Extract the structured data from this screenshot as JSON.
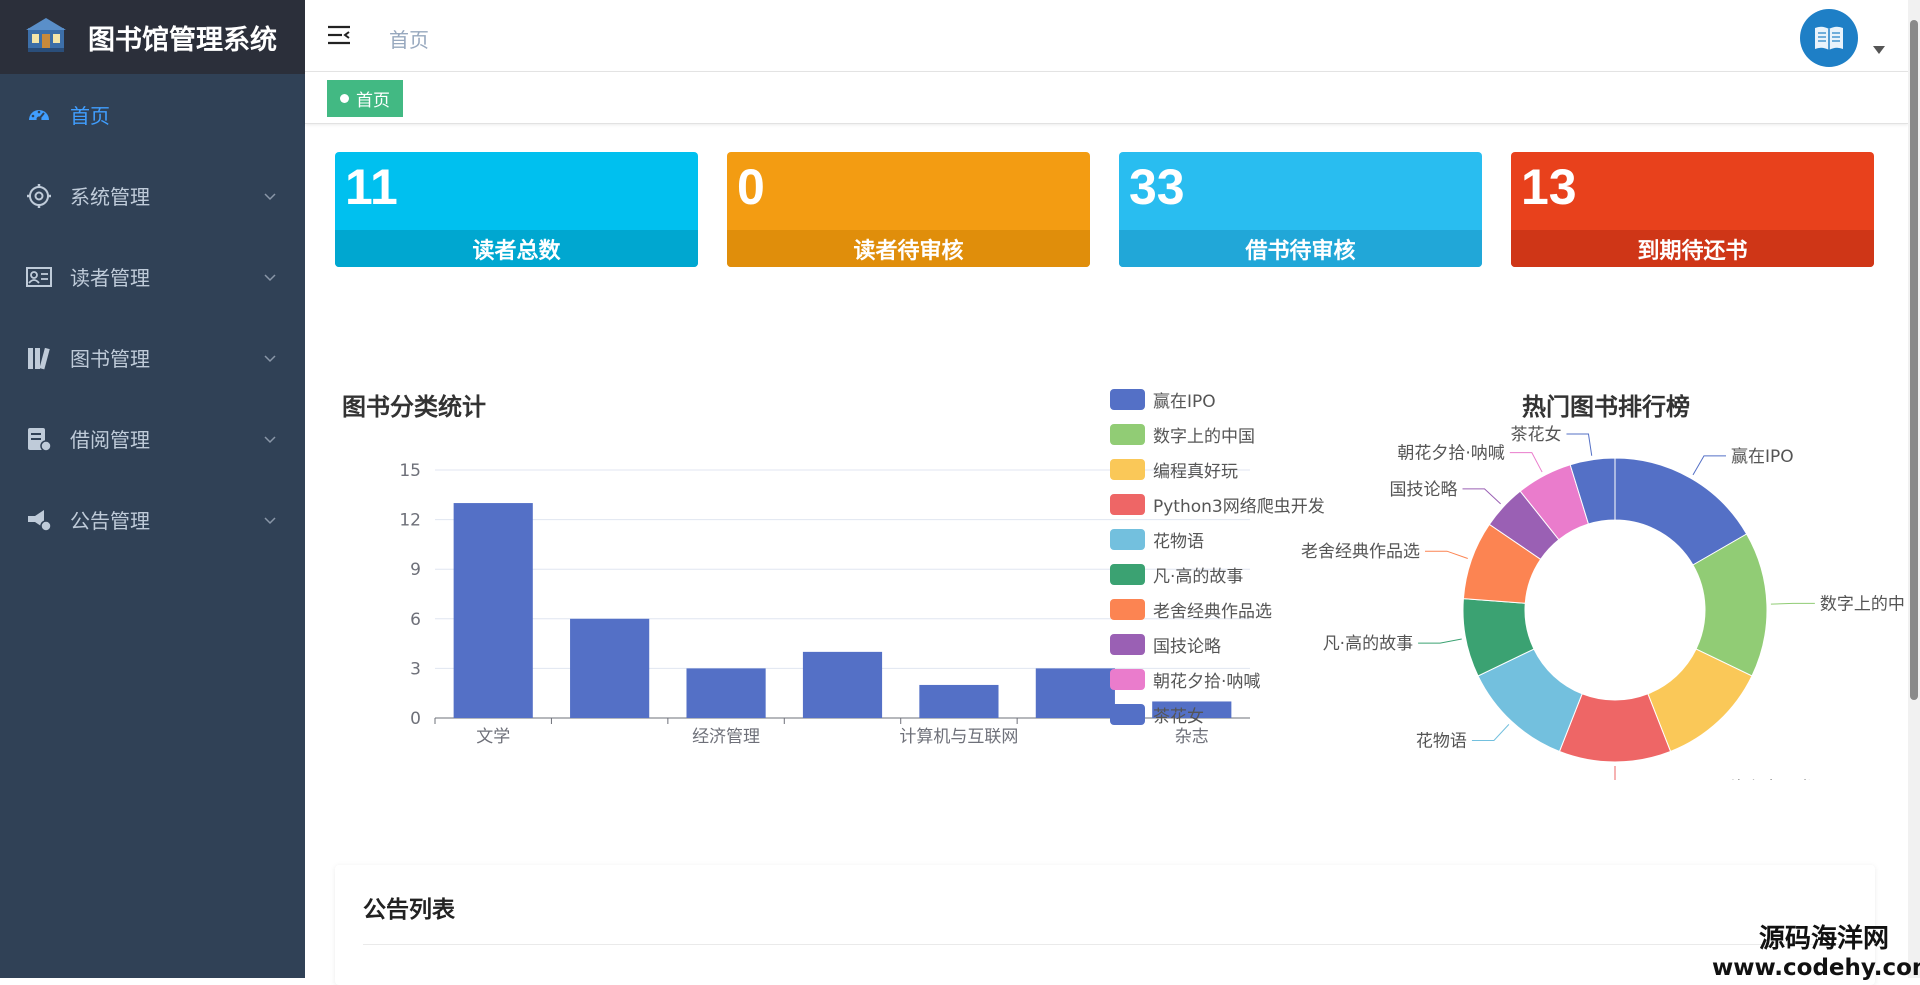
{
  "app": {
    "title": "图书馆管理系统"
  },
  "sidebar": {
    "items": [
      {
        "label": "首页",
        "icon": "dashboard-icon",
        "active": true
      },
      {
        "label": "系统管理",
        "icon": "gear-icon"
      },
      {
        "label": "读者管理",
        "icon": "id-card-icon"
      },
      {
        "label": "图书管理",
        "icon": "books-icon"
      },
      {
        "label": "借阅管理",
        "icon": "borrow-icon"
      },
      {
        "label": "公告管理",
        "icon": "megaphone-icon"
      }
    ]
  },
  "header": {
    "breadcrumb": "首页",
    "avatar_icon": "book-icon"
  },
  "tags": [
    {
      "label": "首页",
      "active": true
    }
  ],
  "stats": [
    {
      "value": "11",
      "label": "读者总数",
      "color": "#00c0ef",
      "foot_color": "#00a7d0"
    },
    {
      "value": "0",
      "label": "读者待审核",
      "color": "#f39c12",
      "foot_color": "#e08e0b"
    },
    {
      "value": "33",
      "label": "借书待审核",
      "color": "#29bdf0",
      "foot_color": "#21a7d8"
    },
    {
      "value": "13",
      "label": "到期待还书",
      "color": "#e8411c",
      "foot_color": "#cf3617"
    }
  ],
  "bar_chart": {
    "title": "图书分类统计"
  },
  "pie_chart": {
    "title": "热门图书排行榜"
  },
  "chart_data": [
    {
      "type": "bar",
      "title": "图书分类统计",
      "categories": [
        "文学",
        "",
        "经济管理",
        "",
        "计算机与互联网",
        "",
        "杂志"
      ],
      "values": [
        13,
        6,
        3,
        4,
        2,
        3,
        1
      ],
      "ylim": [
        0,
        15
      ],
      "yticks": [
        0,
        3,
        6,
        9,
        12,
        15
      ],
      "color": "#5470c6",
      "grid": true
    },
    {
      "type": "pie",
      "title": "热门图书排行榜",
      "donut": true,
      "legend_position": "left",
      "slices": [
        {
          "name": "赢在IPO",
          "value": 14,
          "color": "#5470c6"
        },
        {
          "name": "数字上的中国",
          "value": 13,
          "color": "#91cc75"
        },
        {
          "name": "编程真好玩",
          "value": 10,
          "color": "#fac858"
        },
        {
          "name": "Python3网络爬虫开发",
          "value": 10,
          "color": "#ee6666"
        },
        {
          "name": "花物语",
          "value": 10,
          "color": "#73c0de"
        },
        {
          "name": "凡·高的故事",
          "value": 7,
          "color": "#3ba272"
        },
        {
          "name": "老舍经典作品选",
          "value": 7,
          "color": "#fc8452"
        },
        {
          "name": "国技论略",
          "value": 4,
          "color": "#9a60b4"
        },
        {
          "name": "朝花夕拾·呐喊",
          "value": 5,
          "color": "#ea7ccc"
        },
        {
          "name": "茶花女",
          "value": 4,
          "color": "#5470c6"
        }
      ],
      "outer_labels": [
        "赢在IPO",
        "数字上的中",
        "",
        "Python3网络爬虫开发",
        "花物语",
        "凡·高的故事",
        "老舍经典作品选",
        "国技论略",
        "朝花夕拾·呐喊",
        "茶花女"
      ]
    }
  ],
  "notice": {
    "title": "公告列表"
  },
  "watermark": {
    "line1": "源码海洋网",
    "line2": "www.codehy.com"
  }
}
